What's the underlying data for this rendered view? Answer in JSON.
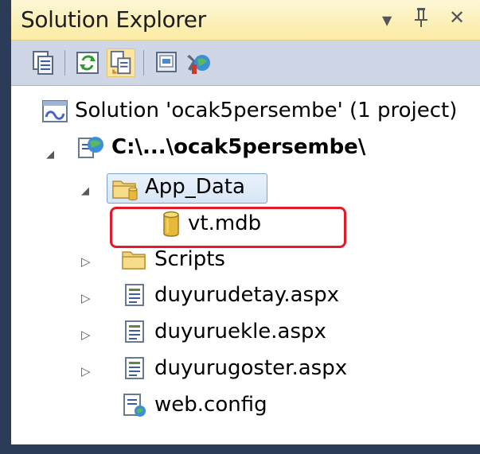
{
  "title": "Solution Explorer",
  "title_buttons": {
    "dropdown": "▼",
    "pin": "Q",
    "close": "✕"
  },
  "toolbar": {
    "buttons": [
      "properties-icon",
      "refresh-icon",
      "show-all-files-icon",
      "view-designer-icon",
      "aspnet-configuration-icon"
    ]
  },
  "tree": {
    "solution": "Solution 'ocak5persembe' (1 project)",
    "project": "C:\\...\\ocak5persembe\\",
    "app_data": "App_Data",
    "db_file": "vt.mdb",
    "scripts": "Scripts",
    "files": [
      "duyurudetay.aspx",
      "duyuruekle.aspx",
      "duyurugoster.aspx"
    ],
    "config": "web.config"
  },
  "expander_glyphs": {
    "expanded": "◢",
    "collapsed": "▷"
  },
  "colors": {
    "frame": "#2b3c59",
    "title_bg": "#fbeba4",
    "toolbar_bg": "#cfd6e5",
    "highlight_border": "#e21a2a"
  }
}
